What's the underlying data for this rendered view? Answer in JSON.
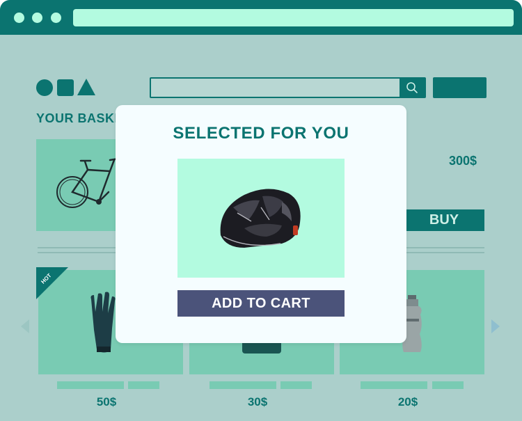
{
  "colors": {
    "primary": "#0b7470",
    "light_mint": "#b3fbe0",
    "card": "#79cbb3",
    "background": "#abcfcb",
    "modal_bg": "#f5fdff",
    "add_button": "#4b537a"
  },
  "icons": {
    "search": "magnifier-icon",
    "logo": [
      "circle-shape",
      "square-shape",
      "triangle-shape"
    ]
  },
  "basket": {
    "title": "YOUR BASKET",
    "price": "300$",
    "buy_label": "BUY"
  },
  "products": [
    {
      "price": "50$",
      "badge": "HOT"
    },
    {
      "price": "30$"
    },
    {
      "price": "20$"
    }
  ],
  "modal": {
    "title": "SELECTED FOR YOU",
    "add_label": "ADD TO CART"
  }
}
